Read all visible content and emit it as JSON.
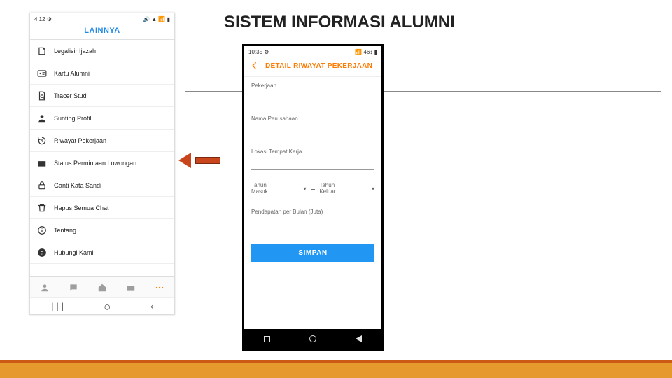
{
  "slide": {
    "title": "SISTEM INFORMASI ALUMNI"
  },
  "left": {
    "status": {
      "time": "4:12",
      "time_icon": "⚙",
      "right": "🔊 ▲ 📶 ▮"
    },
    "tab_header": "LAINNYA",
    "items": [
      {
        "icon": "legalisir",
        "label": "Legalisir Ijazah"
      },
      {
        "icon": "idcard",
        "label": "Kartu Alumni"
      },
      {
        "icon": "tracer",
        "label": "Tracer Studi"
      },
      {
        "icon": "profile",
        "label": "Sunting Profil"
      },
      {
        "icon": "history",
        "label": "Riwayat Pekerjaan"
      },
      {
        "icon": "briefcase",
        "label": "Status Permintaan Lowongan"
      },
      {
        "icon": "lock",
        "label": "Ganti Kata Sandi"
      },
      {
        "icon": "trash",
        "label": "Hapus Semua Chat"
      },
      {
        "icon": "info",
        "label": "Tentang"
      },
      {
        "icon": "help",
        "label": "Hubungi Kami"
      }
    ],
    "nav": {
      "recent": "|||",
      "home": "◯",
      "back": "‹"
    }
  },
  "right": {
    "status": {
      "time": "10:35",
      "time_icon": "⚙",
      "right": "📶 46↕ ▮"
    },
    "header": "DETAIL RIWAYAT PEKERJAAN",
    "fields": {
      "pekerjaan": {
        "label": "Pekerjaan",
        "value": ""
      },
      "perusahaan": {
        "label": "Nama Perusahaan",
        "value": ""
      },
      "lokasi": {
        "label": "Lokasi Tempat Kerja",
        "value": ""
      },
      "tahun_masuk": {
        "label": "Tahun\nMasuk"
      },
      "tahun_keluar": {
        "label": "Tahun\nKeluar"
      },
      "pendapatan": {
        "label": "Pendapatan per Bulan (Juta)",
        "value": ""
      }
    },
    "save_label": "SIMPAN"
  }
}
